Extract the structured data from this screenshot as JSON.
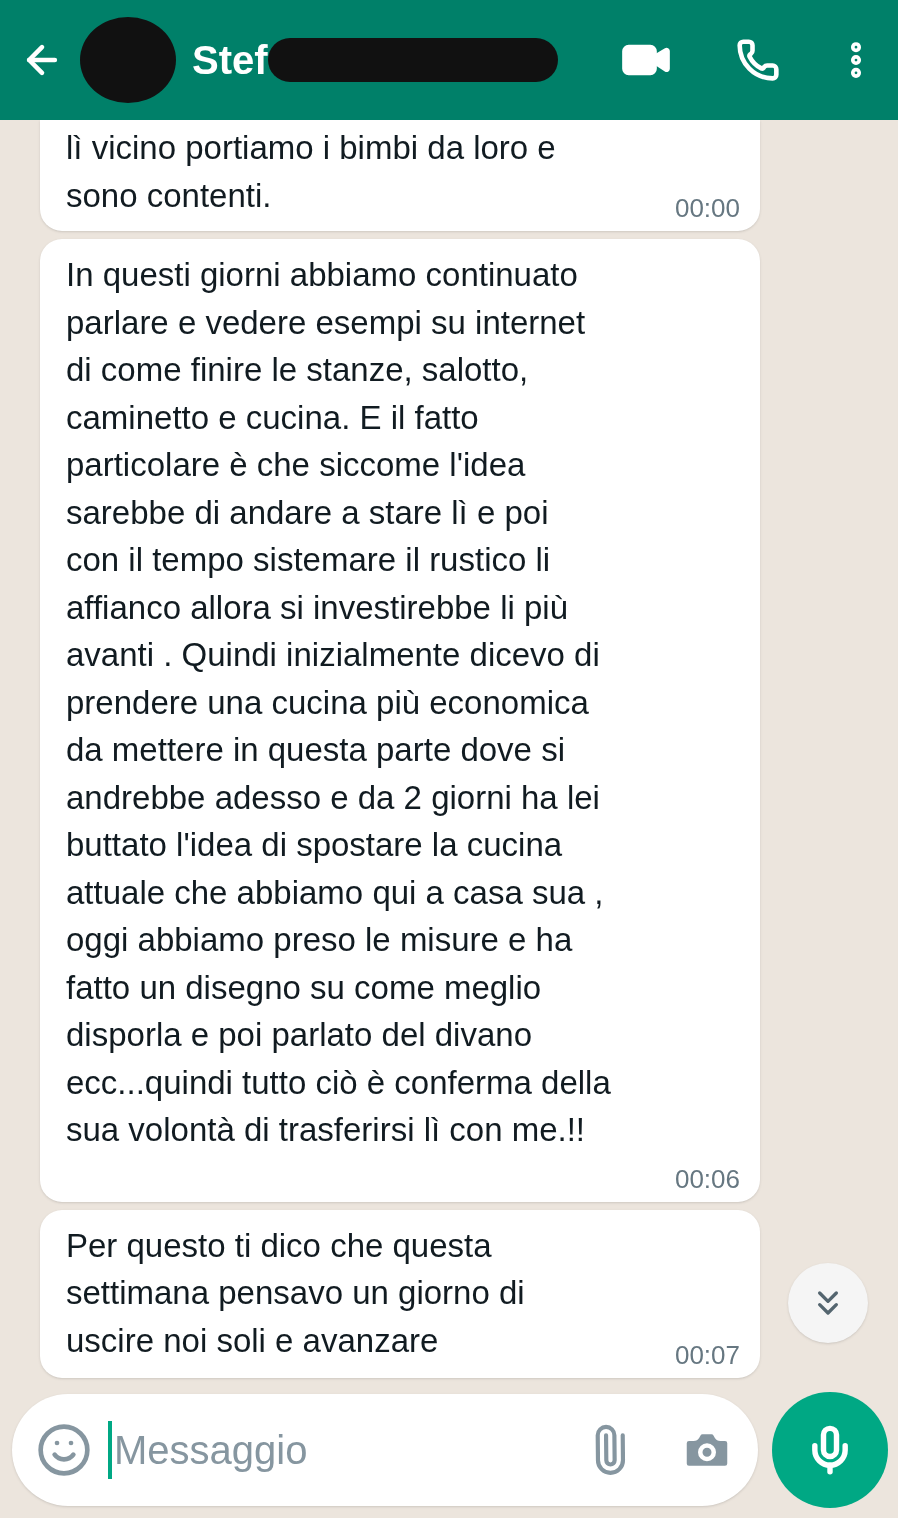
{
  "header": {
    "contact_name": "Stef"
  },
  "messages": [
    {
      "lines": [
        "lì vicino portiamo i bimbi da loro e",
        "sono contenti."
      ],
      "time": "00:00"
    },
    {
      "lines": [
        "In questi giorni abbiamo continuato",
        "parlare e vedere esempi su internet",
        "di come finire le stanze, salotto,",
        "caminetto e cucina. E il fatto",
        "particolare è che siccome l'idea",
        "sarebbe di andare a stare lì e poi",
        "con il tempo sistemare il rustico li",
        "affianco allora si investirebbe li più",
        "avanti . Quindi inizialmente dicevo di",
        "prendere una cucina più economica",
        "da mettere in questa parte dove si",
        "andrebbe adesso e da 2 giorni ha lei",
        "buttato l'idea di spostare la cucina",
        "attuale che abbiamo qui a casa sua ,",
        "oggi abbiamo preso le misure e ha",
        "fatto un disegno su come meglio",
        "disporla e poi parlato del divano",
        "ecc...quindi tutto ciò è conferma della",
        "sua volontà di trasferirsi lì con me.!!"
      ],
      "time": "00:06"
    },
    {
      "lines": [
        "Per questo ti dico che questa",
        "settimana pensavo un giorno di",
        "uscire noi soli e avanzare"
      ],
      "time": "00:07"
    }
  ],
  "composer": {
    "placeholder": "Messaggio"
  }
}
